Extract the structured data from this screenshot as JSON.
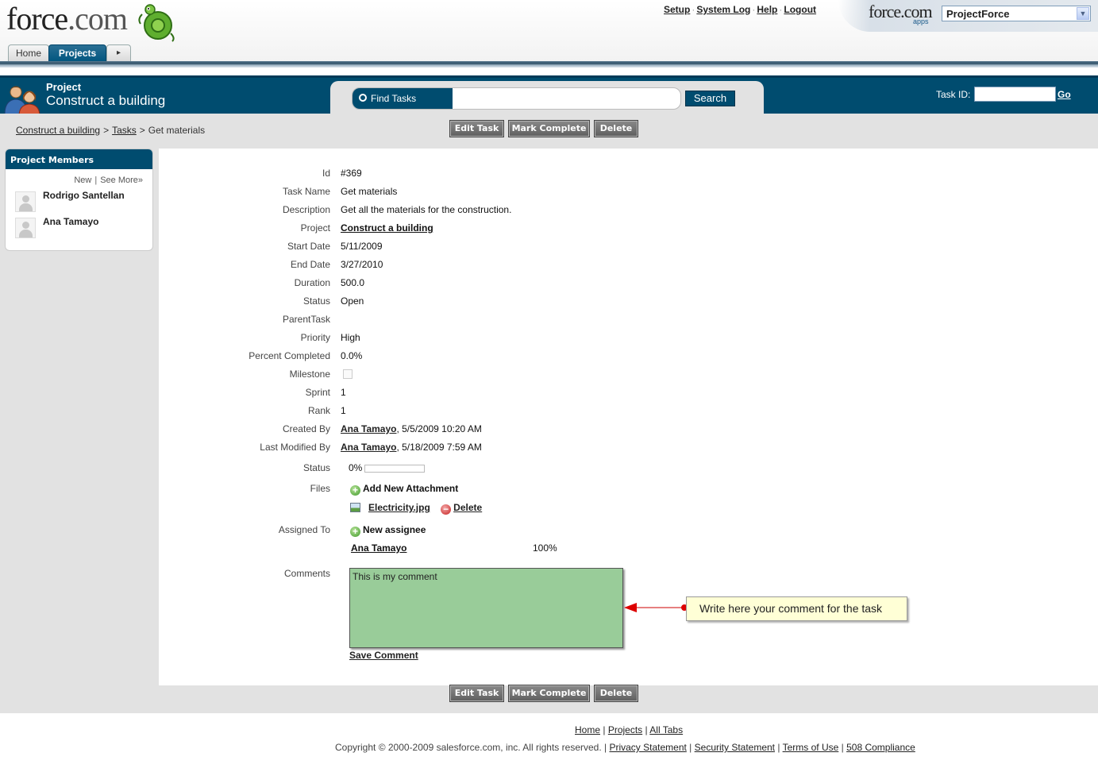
{
  "header": {
    "logo_text": "force.com",
    "logo_text_main": "force",
    "logo_text_domain": ".com",
    "top_links": [
      "Setup",
      "System Log",
      "Help",
      "Logout"
    ],
    "apps_logo": "force.com",
    "apps_logo_sub": "apps",
    "app_selector_value": "ProjectForce",
    "tabs": [
      {
        "label": "Home",
        "active": false
      },
      {
        "label": "Projects",
        "active": true
      }
    ],
    "more_tabs_arrow": "▸"
  },
  "project_bar": {
    "label": "Project",
    "name": "Construct a building",
    "find_label": "Find Tasks",
    "find_value": "",
    "search_button": "Search",
    "task_id_label": "Task ID:",
    "task_id_value": "",
    "go_link": "Go",
    "bar_color": "#004c6f"
  },
  "breadcrumb": {
    "items": [
      "Construct a building",
      "Tasks"
    ],
    "current": "Get materials",
    "separator": ">"
  },
  "actions": {
    "edit": "Edit Task",
    "complete": "Mark Complete",
    "delete": "Delete"
  },
  "sidebar": {
    "title": "Project Members",
    "links": [
      "New",
      "See More»"
    ],
    "members": [
      "Rodrigo Santellan",
      "Ana Tamayo"
    ]
  },
  "task": {
    "fields": [
      {
        "label": "Id",
        "value": "#369"
      },
      {
        "label": "Task Name",
        "value": "Get materials"
      },
      {
        "label": "Description",
        "value": "Get all the materials for the construction."
      },
      {
        "label": "Project",
        "value": "Construct a building"
      },
      {
        "label": "Start Date",
        "value": "5/11/2009"
      },
      {
        "label": "End Date",
        "value": "3/27/2010"
      },
      {
        "label": "Duration",
        "value": "500.0"
      },
      {
        "label": "Status",
        "value": "Open"
      },
      {
        "label": "ParentTask",
        "value": ""
      },
      {
        "label": "Priority",
        "value": "High"
      },
      {
        "label": "Percent Completed",
        "value": "0.0%"
      },
      {
        "label": "Milestone",
        "value": ""
      },
      {
        "label": "Sprint",
        "value": "1"
      },
      {
        "label": "Rank",
        "value": "1"
      }
    ],
    "created_by_label": "Created By",
    "created_by_user": "Ana Tamayo",
    "created_by_date": ", 5/5/2009 10:20 AM",
    "modified_by_label": "Last Modified By",
    "modified_by_user": "Ana Tamayo",
    "modified_by_date": ", 5/18/2009 7:59 AM",
    "progress_label": "Status",
    "progress_text": "0%",
    "progress_fraction": 0.0,
    "files_label": "Files",
    "add_attachment": "Add New Attachment",
    "attachment_name": "Electricity.jpg",
    "attachment_delete": "Delete",
    "assigned_label": "Assigned To",
    "new_assignee": "New assignee",
    "assignee_name": "Ana Tamayo",
    "assignee_percent": "100%",
    "comments_label": "Comments",
    "comment_text": "This is my comment",
    "save_comment": "Save Comment",
    "callout_text": "Write here your comment for the task",
    "comment_box_color": "#99cc99"
  },
  "footer": {
    "nav_links": [
      "Home",
      "Projects",
      "All Tabs"
    ],
    "copyright": "Copyright © 2000-2009 salesforce.com, inc. All rights reserved.",
    "legal_links": [
      "Privacy Statement",
      "Security Statement",
      "Terms of Use",
      "508 Compliance"
    ]
  }
}
